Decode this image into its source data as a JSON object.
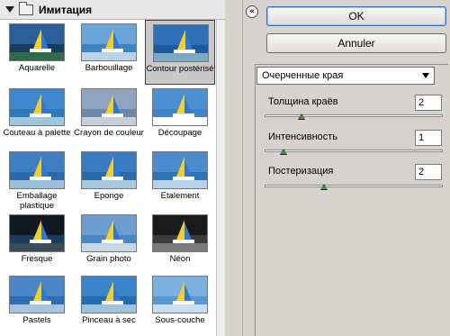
{
  "gallery": {
    "category": "Имитация",
    "selected": "Contour postérisé",
    "filters": [
      {
        "label": "Aquarelle",
        "sky": "#2a5f9a",
        "sea": "#163c62",
        "sand": "#2f6a4a"
      },
      {
        "label": "Barbouillage",
        "sky": "#6aa4d8",
        "sea": "#3b86c2",
        "sand": "#b8d4e6"
      },
      {
        "label": "Contour postérisé",
        "sky": "#2f6fba",
        "sea": "#1c5aa0",
        "sand": "#7aa9c8"
      },
      {
        "label": "Couteau à palette",
        "sky": "#3f88d0",
        "sea": "#2c7ab8",
        "sand": "#9fc6dc"
      },
      {
        "label": "Crayon de couleur",
        "sky": "#8fa4c0",
        "sea": "#6c88aa",
        "sand": "#c8cfd8"
      },
      {
        "label": "Découpage",
        "sky": "#4c8fd0",
        "sea": "#3e86c8",
        "sand": "#ffffff"
      },
      {
        "label": "Emballage plastique",
        "sky": "#3e7fc4",
        "sea": "#2a6aaa",
        "sand": "#9cc0dc"
      },
      {
        "label": "Eponge",
        "sky": "#3a7cc2",
        "sea": "#2c6ba8",
        "sand": "#a8c8de"
      },
      {
        "label": "Etalement",
        "sky": "#4a8ccc",
        "sea": "#2e72b4",
        "sand": "#b6d2e6"
      },
      {
        "label": "Fresque",
        "sky": "#101820",
        "sea": "#1e3a5a",
        "sand": "#3a4c5c"
      },
      {
        "label": "Grain photo",
        "sky": "#6c9cd0",
        "sea": "#4c86c0",
        "sand": "#c4d8e8"
      },
      {
        "label": "Néon",
        "sky": "#1a1a1a",
        "sea": "#3c3c3c",
        "sand": "#7a7a7a"
      },
      {
        "label": "Pastels",
        "sky": "#4a86c8",
        "sea": "#2e6eb0",
        "sand": "#a8c4dc"
      },
      {
        "label": "Pinceau à sec",
        "sky": "#3a84cc",
        "sea": "#236cb0",
        "sand": "#9cc2e0"
      },
      {
        "label": "Sous-couche",
        "sky": "#7ab0e0",
        "sea": "#5a98d0",
        "sand": "#c8deee"
      }
    ]
  },
  "actions": {
    "ok_label": "OK",
    "cancel_label": "Annuler"
  },
  "settings": {
    "filter_dropdown": "Очерченные края",
    "params": [
      {
        "label": "Толщина краёв",
        "value": "2",
        "fraction": 0.2
      },
      {
        "label": "Интенсивность",
        "value": "1",
        "fraction": 0.1
      },
      {
        "label": "Постеризация",
        "value": "2",
        "fraction": 0.33
      }
    ]
  },
  "colors": {
    "ok_border": "#2a6ad8",
    "slider_knob": "#3c9a3c"
  }
}
